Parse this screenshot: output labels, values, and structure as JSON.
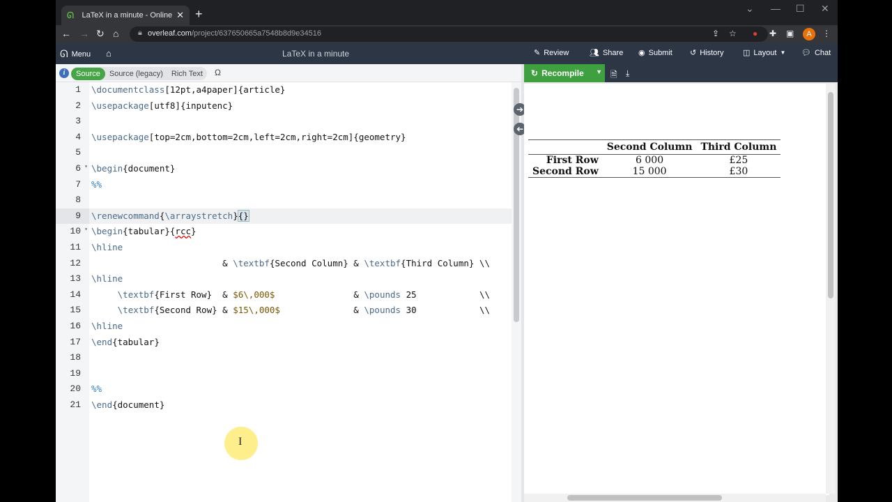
{
  "browser": {
    "tab_title": "LaTeX in a minute - Online LaTeX",
    "url_host": "overleaf.com",
    "url_path": "/project/637650665a7548b8d9e34516",
    "avatar_letter": "A"
  },
  "toolbar": {
    "menu": "Menu",
    "project_title": "LaTeX in a minute",
    "review": "Review",
    "share": "Share",
    "submit": "Submit",
    "history": "History",
    "layout": "Layout",
    "chat": "Chat"
  },
  "editor_header": {
    "modes": [
      "Source",
      "Source (legacy)",
      "Rich Text"
    ],
    "omega": "Ω"
  },
  "code_lines": [
    "\\documentclass[12pt,a4paper]{article}",
    "\\usepackage[utf8]{inputenc}",
    "",
    "\\usepackage[top=2cm,bottom=2cm,left=2cm,right=2cm]{geometry}",
    "",
    "\\begin{document}",
    "%%",
    "",
    "\\renewcommand{\\arraystretch}{}",
    "\\begin{tabular}{rcc}",
    "\\hline",
    "                         & \\textbf{Second Column} & \\textbf{Third Column} \\\\",
    "\\hline",
    "     \\textbf{First Row}  & $6\\,000$               & \\pounds 25            \\\\",
    "     \\textbf{Second Row} & $15\\,000$              & \\pounds 30            \\\\",
    "\\hline",
    "\\end{tabular}",
    "",
    "",
    "%%",
    "\\end{document}"
  ],
  "pdf": {
    "recompile": "Recompile",
    "table": {
      "headers": [
        "",
        "Second Column",
        "Third Column"
      ],
      "rows": [
        [
          "First Row",
          "6 000",
          "£25"
        ],
        [
          "Second Row",
          "15 000",
          "£30"
        ]
      ]
    }
  },
  "colors": {
    "accent_green": "#3fa040",
    "toolbar_bg": "#2c3645"
  }
}
